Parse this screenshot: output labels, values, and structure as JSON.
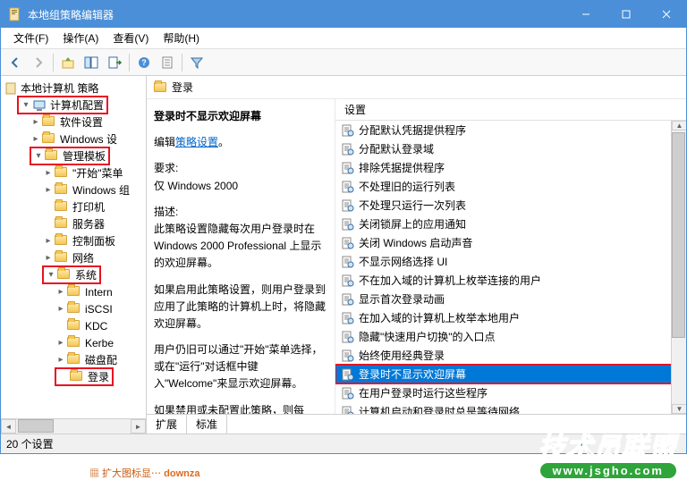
{
  "window": {
    "title": "本地组策略编辑器"
  },
  "menubar": [
    "文件(F)",
    "操作(A)",
    "查看(V)",
    "帮助(H)"
  ],
  "tree": {
    "root": "本地计算机 策略",
    "nodes": [
      {
        "indent": 1,
        "expand": "▾",
        "icon": "comp",
        "label": "计算机配置",
        "redbox": true
      },
      {
        "indent": 2,
        "expand": "▸",
        "icon": "folder",
        "label": "软件设置"
      },
      {
        "indent": 2,
        "expand": "▸",
        "icon": "folder",
        "label": "Windows 设"
      },
      {
        "indent": 2,
        "expand": "▾",
        "icon": "folder",
        "label": "管理模板",
        "redbox": true
      },
      {
        "indent": 3,
        "expand": "▸",
        "icon": "folder",
        "label": "\"开始\"菜单"
      },
      {
        "indent": 3,
        "expand": "▸",
        "icon": "folder",
        "label": "Windows 组"
      },
      {
        "indent": 3,
        "expand": "",
        "icon": "folder",
        "label": "打印机"
      },
      {
        "indent": 3,
        "expand": "",
        "icon": "folder",
        "label": "服务器"
      },
      {
        "indent": 3,
        "expand": "▸",
        "icon": "folder",
        "label": "控制面板"
      },
      {
        "indent": 3,
        "expand": "▸",
        "icon": "folder",
        "label": "网络"
      },
      {
        "indent": 3,
        "expand": "▾",
        "icon": "folder",
        "label": "系统",
        "redbox": true
      },
      {
        "indent": 4,
        "expand": "▸",
        "icon": "folder",
        "label": "Intern"
      },
      {
        "indent": 4,
        "expand": "▸",
        "icon": "folder",
        "label": "iSCSI"
      },
      {
        "indent": 4,
        "expand": "",
        "icon": "folder",
        "label": "KDC"
      },
      {
        "indent": 4,
        "expand": "▸",
        "icon": "folder",
        "label": "Kerbe"
      },
      {
        "indent": 4,
        "expand": "▸",
        "icon": "folder",
        "label": "磁盘配"
      },
      {
        "indent": 4,
        "expand": "",
        "icon": "folder",
        "label": "登录",
        "redbox": true
      }
    ]
  },
  "detail": {
    "folder_title": "登录",
    "selected_title": "登录时不显示欢迎屏幕",
    "edit_prefix": "编辑",
    "edit_link": "策略设置",
    "req_label": "要求:",
    "req_value": "仅 Windows 2000",
    "desc_label": "描述:",
    "desc_p1": "此策略设置隐藏每次用户登录时在 Windows 2000 Professional 上显示的欢迎屏幕。",
    "desc_p2": "如果启用此策略设置，则用户登录到应用了此策略的计算机上时，将隐藏欢迎屏幕。",
    "desc_p3": "用户仍旧可以通过\"开始\"菜单选择，或在\"运行\"对话框中键入\"Welcome\"来显示欢迎屏幕。",
    "desc_p4": "如果禁用或未配置此策略，则每"
  },
  "list": {
    "header": "设置",
    "items": [
      "分配默认凭据提供程序",
      "分配默认登录域",
      "排除凭据提供程序",
      "不处理旧的运行列表",
      "不处理只运行一次列表",
      "关闭锁屏上的应用通知",
      "关闭 Windows 启动声音",
      "不显示网络选择 UI",
      "不在加入域的计算机上枚举连接的用户",
      "显示首次登录动画",
      "在加入域的计算机上枚举本地用户",
      "隐藏\"快速用户切换\"的入口点",
      "始终使用经典登录",
      "登录时不显示欢迎屏幕",
      "在用户登录时运行这些程序",
      "计算机启动和登录时总是等待网络"
    ],
    "selected_index": 13
  },
  "tabs": {
    "items": [
      "扩展",
      "标准"
    ],
    "active": 0
  },
  "statusbar": {
    "text": "20 个设置"
  },
  "watermark": {
    "text": "技术员联盟",
    "url": "www.jsgho.com"
  }
}
